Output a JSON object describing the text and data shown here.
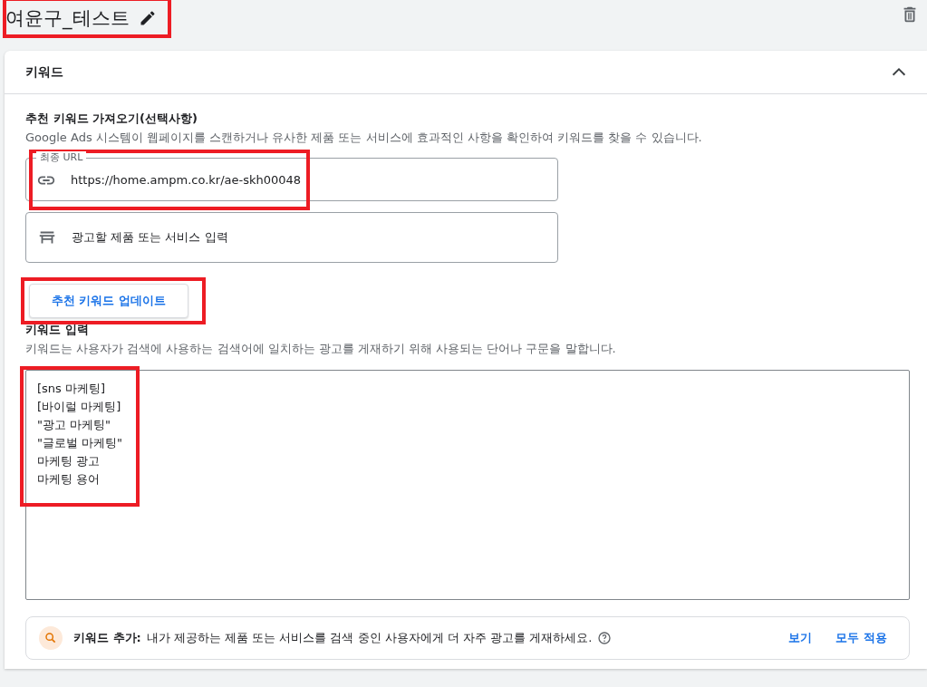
{
  "header": {
    "title": "여윤구_테스트",
    "highlighted": true
  },
  "card": {
    "title": "키워드",
    "expanded": true,
    "suggest": {
      "heading": "추천 키워드 가져오기(선택사항)",
      "description": "Google Ads 시스템이 웹페이지를 스캔하거나 유사한 제품 또는 서비스에 효과적인 사항을 확인하여 키워드를 찾을 수 있습니다.",
      "url_field": {
        "label": "최종 URL",
        "value": "https://home.ampm.co.kr/ae-skh00048",
        "highlighted": true
      },
      "product_field": {
        "placeholder": "광고할 제품 또는 서비스 입력"
      },
      "update_button": {
        "label": "추천 키워드 업데이트",
        "highlighted": true
      }
    },
    "keywords": {
      "heading": "키워드 입력",
      "description": "키워드는 사용자가 검색에 사용하는 검색어에 일치하는 광고를 게재하기 위해 사용되는 단어나 구문을 말합니다.",
      "lines": [
        "[sns 마케팅]",
        "[바이럴 마케팅]",
        "\"광고 마케팅\"",
        "\"글로벌 마케팅\"",
        "마케팅 광고",
        "마케팅 용어"
      ],
      "highlighted": true
    },
    "banner": {
      "label": "키워드 추가:",
      "text": "내가 제공하는 제품 또는 서비스를 검색 중인 사용자에게 더 자주 광고를 게재하세요.",
      "actions": [
        "보기",
        "모두 적용"
      ]
    }
  }
}
